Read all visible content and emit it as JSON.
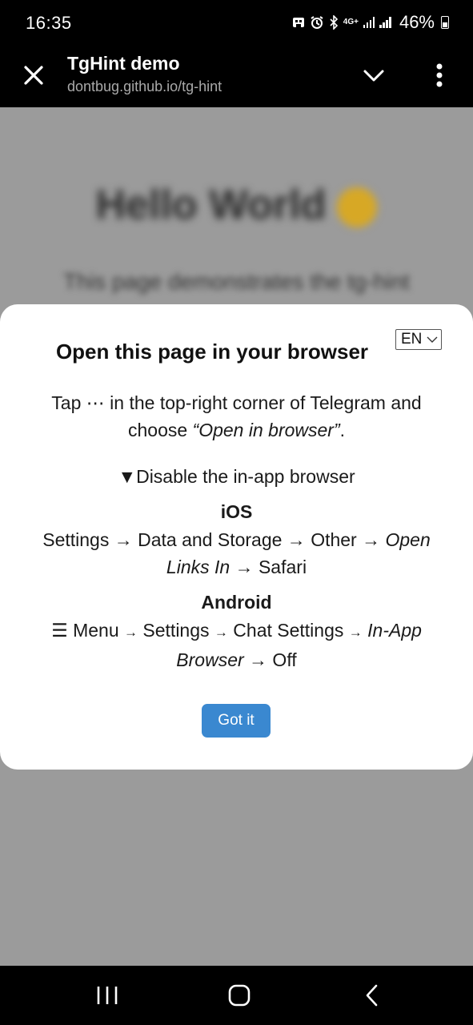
{
  "status_bar": {
    "time": "16:35",
    "network": "4G+",
    "battery": "46%"
  },
  "browser": {
    "title": "TgHint demo",
    "url": "dontbug.github.io/tg-hint",
    "icons": [
      "close-icon",
      "chevron-down-icon",
      "more-vert-icon"
    ]
  },
  "background_page": {
    "heading": "Hello World",
    "subtext": "This page demonstrates the tg-hint"
  },
  "modal": {
    "language": "EN",
    "title": "Open this page in your browser",
    "instruction_tap": "Tap",
    "instruction_dots": "⋯",
    "instruction_rest": " in the top-right corner of Telegram and choose ",
    "instruction_em": "“Open in browser”",
    "instruction_end": ".",
    "disable_toggle": "▼",
    "disable_label": "Disable the in-app browser",
    "ios_heading": "iOS",
    "ios_path": "Settings → Data and Storage → Other → ",
    "ios_path_em": "Open Links In",
    "ios_path_end": " → Safari",
    "android_heading": "Android",
    "android_menu_icon": "☰",
    "android_menu": " Menu ",
    "android_settings": " Settings ",
    "android_chat": " Chat Settings ",
    "android_arrow": "→",
    "android_em": "In-App Browser",
    "android_end": " → Off",
    "button": "Got it"
  },
  "nav_bar": {
    "icons": [
      "recents-icon",
      "home-icon",
      "back-icon"
    ]
  },
  "colors": {
    "accent_button": "#3a88d0",
    "overlay": "#9b9b9b"
  }
}
